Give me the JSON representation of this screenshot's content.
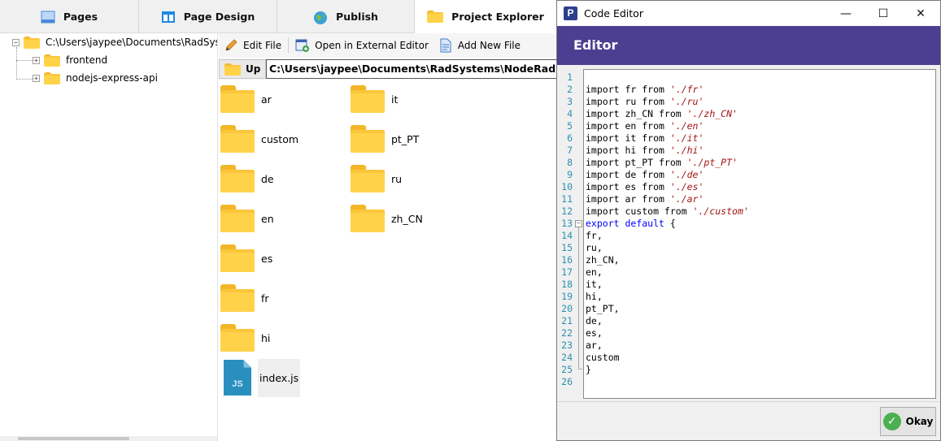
{
  "tabs": [
    {
      "label": "Pages",
      "icon": "pages-icon"
    },
    {
      "label": "Page Design",
      "icon": "layout-icon"
    },
    {
      "label": "Publish",
      "icon": "globe-icon"
    },
    {
      "label": "Project Explorer",
      "icon": "folder-icon",
      "active": true
    }
  ],
  "tree": {
    "root": "C:\\Users\\jaypee\\Documents\\RadSystems\\NodeRad Projects",
    "children": [
      "frontend",
      "nodejs-express-api"
    ]
  },
  "toolbar": {
    "edit_file": "Edit File",
    "open_external": "Open in External Editor",
    "add_new_file": "Add New File"
  },
  "pathbar": {
    "up_label": "Up",
    "path": "C:\\Users\\jaypee\\Documents\\RadSystems\\NodeRad Projects"
  },
  "files": [
    {
      "name": "ar",
      "type": "folder"
    },
    {
      "name": "custom",
      "type": "folder"
    },
    {
      "name": "de",
      "type": "folder"
    },
    {
      "name": "en",
      "type": "folder"
    },
    {
      "name": "es",
      "type": "folder"
    },
    {
      "name": "fr",
      "type": "folder"
    },
    {
      "name": "hi",
      "type": "folder"
    },
    {
      "name": "index.js",
      "type": "js",
      "icon_text": "JS",
      "selected": true
    },
    {
      "name": "it",
      "type": "folder"
    },
    {
      "name": "pt_PT",
      "type": "folder"
    },
    {
      "name": "ru",
      "type": "folder"
    },
    {
      "name": "zh_CN",
      "type": "folder"
    }
  ],
  "editor_window": {
    "title": "Code Editor",
    "app_icon_letter": "P",
    "header": "Editor",
    "minimize": "—",
    "maximize": "☐",
    "close": "✕",
    "ok_label": "Okay"
  },
  "code_lines": [
    "",
    "import fr from './fr'",
    "import ru from './ru'",
    "import zh_CN from './zh_CN'",
    "import en from './en'",
    "import it from './it'",
    "import hi from './hi'",
    "import pt_PT from './pt_PT'",
    "import de from './de'",
    "import es from './es'",
    "import ar from './ar'",
    "import custom from './custom'",
    "export default {",
    "fr,",
    "ru,",
    "zh_CN,",
    "en,",
    "it,",
    "hi,",
    "pt_PT,",
    "de,",
    "es,",
    "ar,",
    "custom",
    "}",
    ""
  ],
  "colors": {
    "editor_header": "#4c3f91",
    "folder": "#fbc63a",
    "js_icon": "#2a8fbf",
    "keyword": "#0000ff",
    "string": "#a31515",
    "line_number": "#2b91af"
  }
}
